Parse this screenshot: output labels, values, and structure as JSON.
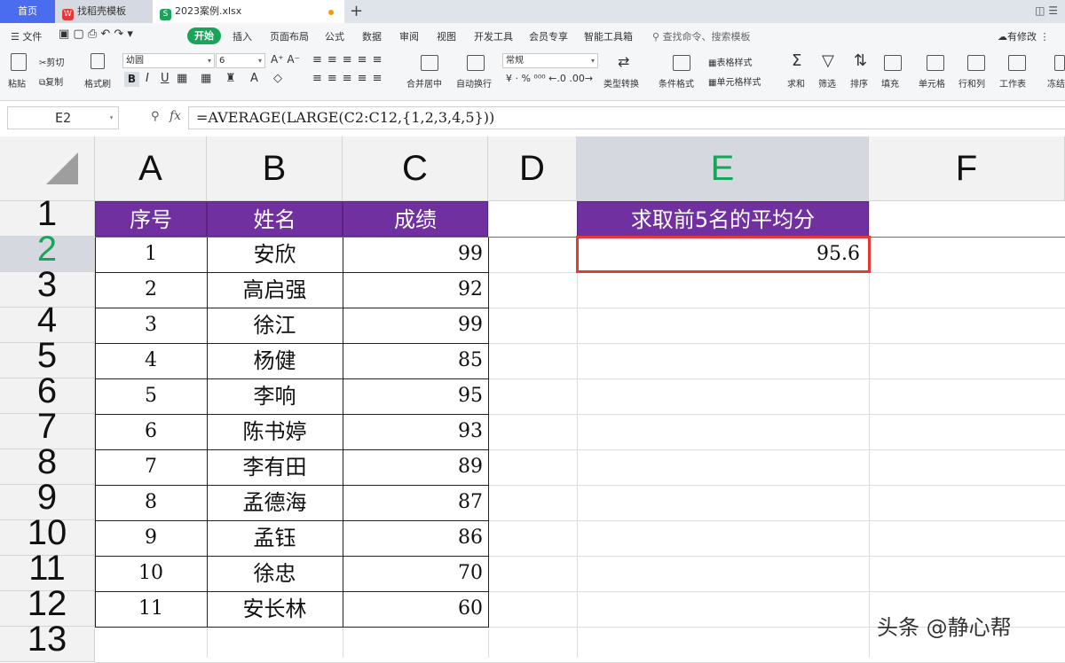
{
  "tabs": {
    "home": "首页",
    "template": "找稻壳模板",
    "file": "2023案例.xlsx",
    "template_icon": "W",
    "file_icon": "S",
    "new_tab": "+"
  },
  "menu": {
    "file": "文件",
    "start": "开始",
    "items": [
      "插入",
      "页面布局",
      "公式",
      "数据",
      "审阅",
      "视图",
      "开发工具",
      "会员专享",
      "智能工具箱"
    ],
    "search": "查找命令、搜索模板",
    "has_change": "有修改"
  },
  "ribbon": {
    "paste": "粘贴",
    "cut": "剪切",
    "copy": "复制",
    "format_painter": "格式刷",
    "font_name": "幼圆",
    "font_size": "6",
    "merge_center": "合并居中",
    "wrap_text": "自动换行",
    "number_format": "常规",
    "type_convert": "类型转换",
    "cond_format": "条件格式",
    "table_style": "表格样式",
    "cell_style": "单元格样式",
    "sum": "求和",
    "filter": "筛选",
    "sort": "排序",
    "fill": "填充",
    "cell": "单元格",
    "row_col": "行和列",
    "worksheet": "工作表",
    "freeze": "冻结"
  },
  "formula_bar": {
    "name_box": "E2",
    "fx": "fx",
    "formula": "=AVERAGE(LARGE(C2:C12,{1,2,3,4,5}))"
  },
  "columns": [
    "A",
    "B",
    "C",
    "D",
    "E",
    "F"
  ],
  "selected_column": "E",
  "rows": [
    "1",
    "2",
    "3",
    "4",
    "5",
    "6",
    "7",
    "8",
    "9",
    "10",
    "11",
    "12",
    "13"
  ],
  "selected_row": "2",
  "table": {
    "headers": [
      "序号",
      "姓名",
      "成绩"
    ],
    "data": [
      [
        "1",
        "安欣",
        "99"
      ],
      [
        "2",
        "高启强",
        "92"
      ],
      [
        "3",
        "徐江",
        "99"
      ],
      [
        "4",
        "杨健",
        "85"
      ],
      [
        "5",
        "李响",
        "95"
      ],
      [
        "6",
        "陈书婷",
        "93"
      ],
      [
        "7",
        "李有田",
        "89"
      ],
      [
        "8",
        "孟德海",
        "87"
      ],
      [
        "9",
        "孟钰",
        "86"
      ],
      [
        "10",
        "徐忠",
        "70"
      ],
      [
        "11",
        "安长林",
        "60"
      ]
    ]
  },
  "result": {
    "header": "求取前5名的平均分",
    "value": "95.6"
  },
  "colors": {
    "header_fill": "#7030a0",
    "accent": "#1aa35a",
    "selection": "#e53935"
  },
  "watermark": "头条 @静心帮"
}
